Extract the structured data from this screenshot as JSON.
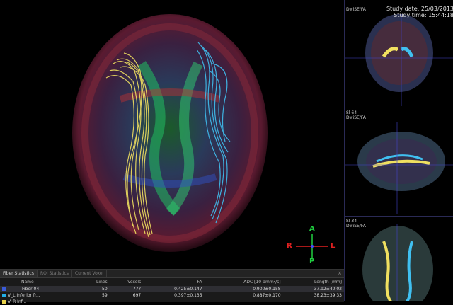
{
  "study": {
    "date": "Study date: 25/03/2013",
    "time": "Study time: 15:44:18"
  },
  "orientation": {
    "anterior": "A",
    "right": "R",
    "left": "L",
    "posterior": "P"
  },
  "viewports": [
    {
      "series": "DwiSE/FA",
      "slice": ""
    },
    {
      "series": "DwiSE/FA",
      "slice": "Sl 64"
    },
    {
      "series": "DwiSE/FA",
      "slice": "Sl 34"
    }
  ],
  "tabs": [
    "Fiber Statistics",
    "ROI Statistics",
    "Current Voxel"
  ],
  "close_glyph": "×",
  "table": {
    "headers": [
      "Name",
      "Lines",
      "Voxels",
      "FA",
      "ADC [10-9mm²/s]",
      "Length [mm]"
    ],
    "rows": [
      {
        "name": "Fiber 04",
        "lines": "50",
        "voxels": "777",
        "fa": "0.425±0.147",
        "adc": "0.900±0.158",
        "length": "37.92±40.02",
        "color": "#3a5bd8"
      },
      {
        "name": "V_L Inferior fr...",
        "lines": "59",
        "voxels": "697",
        "fa": "0.397±0.135",
        "adc": "0.887±0.170",
        "length": "38.23±39.33",
        "color": "#22aee8"
      },
      {
        "name": "V_R Inf...",
        "lines": "",
        "voxels": "",
        "fa": "",
        "adc": "",
        "length": "",
        "color": "#e8d24a"
      }
    ]
  },
  "colors": {
    "tract_left": "#f0e060",
    "tract_right": "#40c0f0",
    "axis_red": "#e02020",
    "axis_green": "#20d040"
  }
}
